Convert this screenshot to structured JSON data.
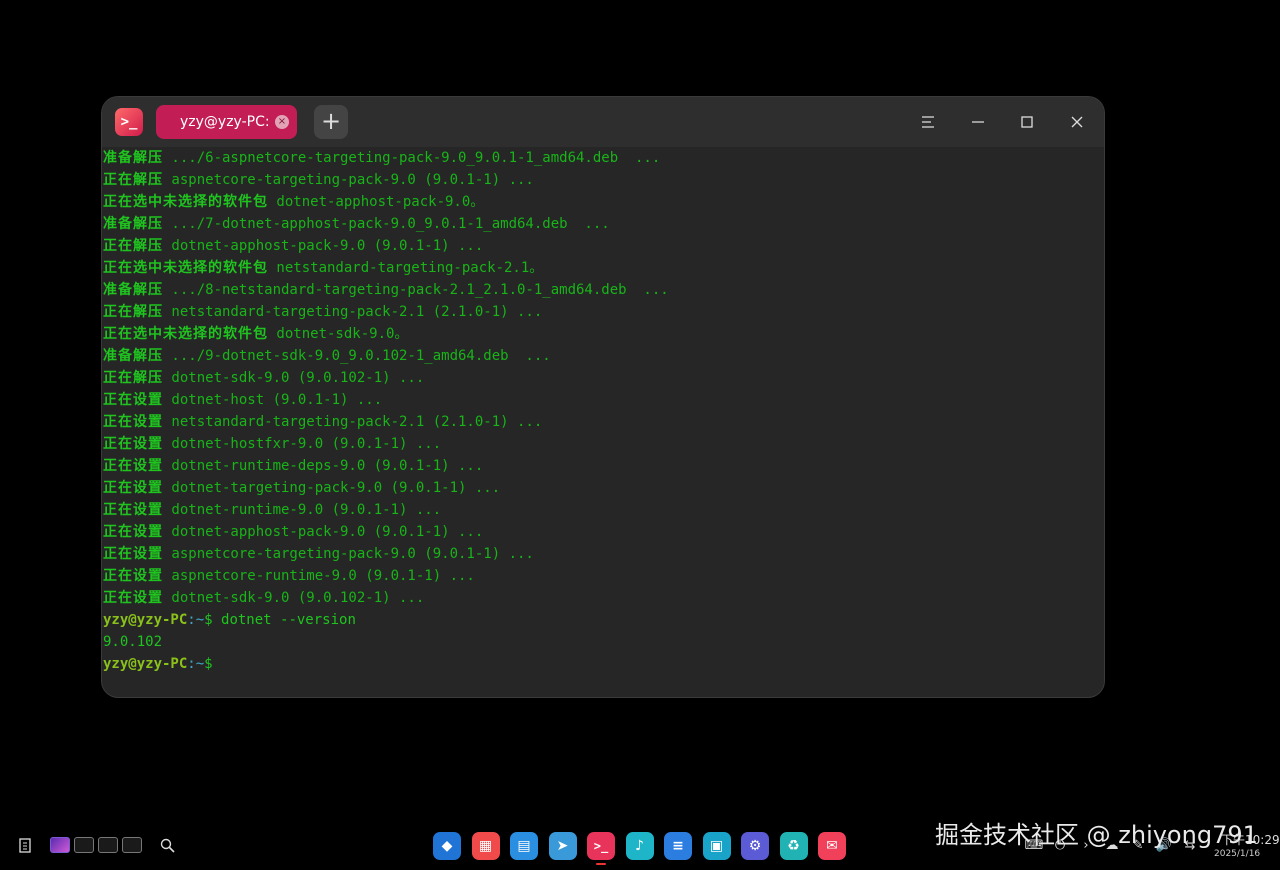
{
  "window": {
    "app_icon_glyph": ">_",
    "tab_title": "yzy@yzy-PC: ~",
    "tab_close_glyph": "×",
    "new_tab_glyph": "+",
    "menu_icon": "hamburger-menu-icon",
    "minimize_icon": "minimize-icon",
    "maximize_icon": "maximize-icon",
    "close_icon": "close-icon"
  },
  "terminal": {
    "lines": [
      {
        "cn": "准备解压",
        "text": " .../6-aspnetcore-targeting-pack-9.0_9.0.1-1_amd64.deb  ..."
      },
      {
        "cn": "正在解压",
        "text": " aspnetcore-targeting-pack-9.0 (9.0.1-1) ..."
      },
      {
        "cn": "正在选中未选择的软件包",
        "text": " dotnet-apphost-pack-9.0。"
      },
      {
        "cn": "准备解压",
        "text": " .../7-dotnet-apphost-pack-9.0_9.0.1-1_amd64.deb  ..."
      },
      {
        "cn": "正在解压",
        "text": " dotnet-apphost-pack-9.0 (9.0.1-1) ..."
      },
      {
        "cn": "正在选中未选择的软件包",
        "text": " netstandard-targeting-pack-2.1。"
      },
      {
        "cn": "准备解压",
        "text": " .../8-netstandard-targeting-pack-2.1_2.1.0-1_amd64.deb  ..."
      },
      {
        "cn": "正在解压",
        "text": " netstandard-targeting-pack-2.1 (2.1.0-1) ..."
      },
      {
        "cn": "正在选中未选择的软件包",
        "text": " dotnet-sdk-9.0。"
      },
      {
        "cn": "准备解压",
        "text": " .../9-dotnet-sdk-9.0_9.0.102-1_amd64.deb  ..."
      },
      {
        "cn": "正在解压",
        "text": " dotnet-sdk-9.0 (9.0.102-1) ..."
      },
      {
        "cn": "正在设置",
        "text": " dotnet-host (9.0.1-1) ..."
      },
      {
        "cn": "正在设置",
        "text": " netstandard-targeting-pack-2.1 (2.1.0-1) ..."
      },
      {
        "cn": "正在设置",
        "text": " dotnet-hostfxr-9.0 (9.0.1-1) ..."
      },
      {
        "cn": "正在设置",
        "text": " dotnet-runtime-deps-9.0 (9.0.1-1) ..."
      },
      {
        "cn": "正在设置",
        "text": " dotnet-targeting-pack-9.0 (9.0.1-1) ..."
      },
      {
        "cn": "正在设置",
        "text": " dotnet-runtime-9.0 (9.0.1-1) ..."
      },
      {
        "cn": "正在设置",
        "text": " dotnet-apphost-pack-9.0 (9.0.1-1) ..."
      },
      {
        "cn": "正在设置",
        "text": " aspnetcore-targeting-pack-9.0 (9.0.1-1) ..."
      },
      {
        "cn": "正在设置",
        "text": " aspnetcore-runtime-9.0 (9.0.1-1) ..."
      },
      {
        "cn": "正在设置",
        "text": " dotnet-sdk-9.0 (9.0.102-1) ..."
      }
    ],
    "prompt_user": "yzy@yzy-PC",
    "prompt_path": ":~",
    "prompt_symbol": "$",
    "command": " dotnet --version",
    "output": "9.0.102"
  },
  "taskbar": {
    "left_icons": [
      "clipboard-icon",
      "workspace-thumbnail",
      "search-icon"
    ],
    "dock_apps": [
      {
        "name": "launcher",
        "color": "#1f74d6",
        "glyph": "◆"
      },
      {
        "name": "app-store",
        "color": "#f04a4a",
        "glyph": "▦"
      },
      {
        "name": "file-manager",
        "color": "#2a8fe0",
        "glyph": "▤"
      },
      {
        "name": "browser",
        "color": "#3a9ad9",
        "glyph": "➤"
      },
      {
        "name": "terminal",
        "color": "#e8335a",
        "glyph": ">_"
      },
      {
        "name": "music",
        "color": "#1fb5c9",
        "glyph": "♪"
      },
      {
        "name": "text-editor",
        "color": "#2b7de0",
        "glyph": "≡"
      },
      {
        "name": "control-center",
        "color": "#1aa3c8",
        "glyph": "▣"
      },
      {
        "name": "settings",
        "color": "#5b5bd6",
        "glyph": "⚙"
      },
      {
        "name": "trash",
        "color": "#21b3b3",
        "glyph": "♻"
      },
      {
        "name": "feedback",
        "color": "#f0405a",
        "glyph": "✉"
      }
    ],
    "clock_time": "下午10:29",
    "clock_date": "2025/1/16",
    "tray_icons": [
      "keyboard-icon",
      "power-icon",
      "next-icon",
      "network-icon",
      "pen-icon",
      "volume-icon",
      "toggle-icon"
    ]
  },
  "watermark": "掘金技术社区 @ zhiyong791"
}
